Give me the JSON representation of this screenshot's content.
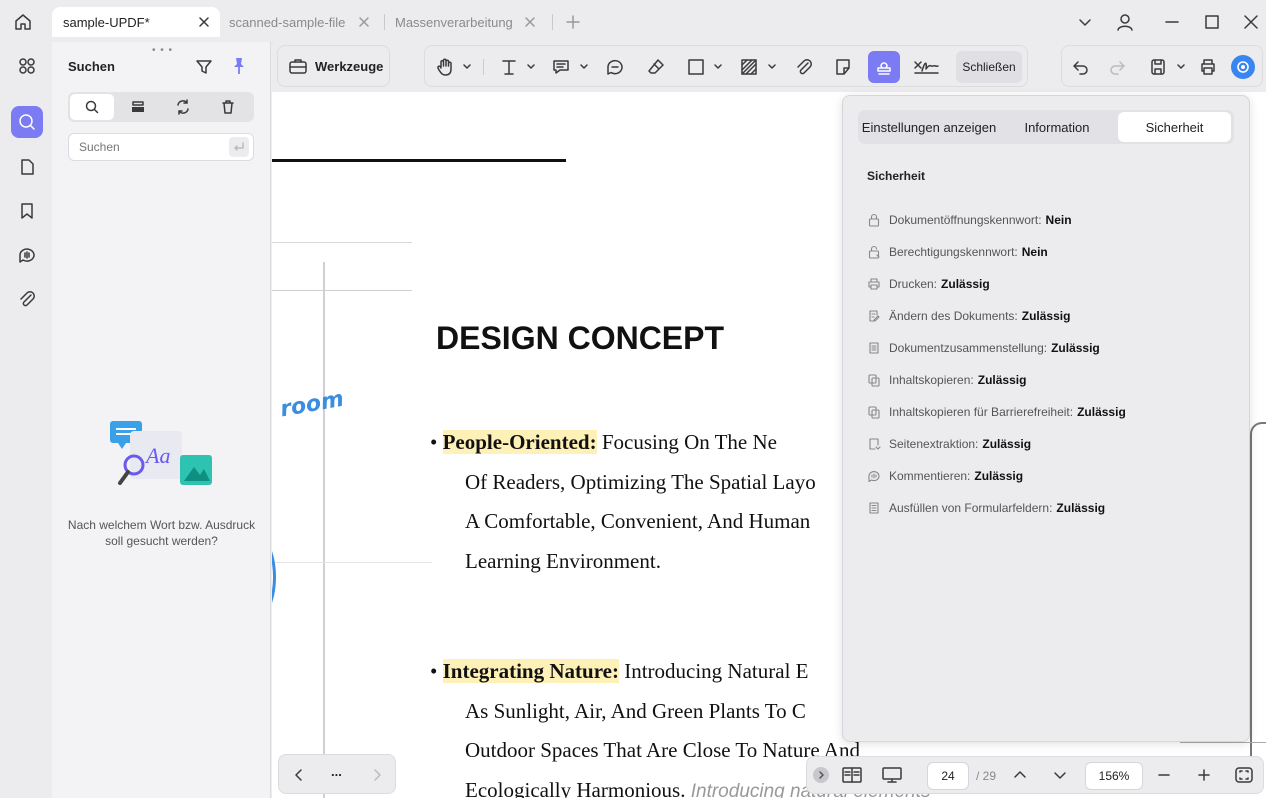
{
  "tabs": [
    {
      "label": "sample-UPDF*",
      "active": true
    },
    {
      "label": "scanned-sample-file",
      "active": false
    },
    {
      "label": "Massenverarbeitung",
      "active": false
    }
  ],
  "search_panel": {
    "title": "Suchen",
    "placeholder": "Suchen",
    "empty_hint_line1": "Nach welchem Wort bzw. Ausdruck",
    "empty_hint_line2": "soll gesucht werden?"
  },
  "toolbar": {
    "tools_label": "Werkzeuge",
    "close_label": "Schließen"
  },
  "document": {
    "handwriting": "room",
    "heading": "DESIGN CONCEPT",
    "bullet1_bold": "People-Oriented:",
    "bullet1_rest": " Focusing On The        Ne",
    "bullet1_line2": "Of Readers, Optimizing The Spatial Layo",
    "bullet1_line3": "A Comfortable, Convenient, And Human",
    "bullet1_line4": "Learning Environment.",
    "bullet2_bold": "Integrating Nature:",
    "bullet2_rest": " Introducing Natural E",
    "bullet2_line2": "As Sunlight, Air, And Green Plants To C",
    "bullet2_line3": "Outdoor Spaces That Are Close To Nature And",
    "bullet2_line4": "Ecologically Harmonious.",
    "bullet2_line4_italic": " Introducing natural elements"
  },
  "properties": {
    "tabs": [
      "Einstellungen anzeigen",
      "Information",
      "Sicherheit"
    ],
    "active_tab": "Sicherheit",
    "section_title": "Sicherheit",
    "rows": [
      {
        "label": "Dokumentöffnungskennwort:",
        "value": "Nein",
        "icon": "lock-icon"
      },
      {
        "label": "Berechtigungskennwort:",
        "value": "Nein",
        "icon": "permission-lock-icon"
      },
      {
        "label": "Drucken:",
        "value": "Zulässig",
        "icon": "printer-icon"
      },
      {
        "label": "Ändern des Dokuments:",
        "value": "Zulässig",
        "icon": "edit-document-icon"
      },
      {
        "label": "Dokumentzusammenstellung:",
        "value": "Zulässig",
        "icon": "document-assembly-icon"
      },
      {
        "label": "Inhaltskopieren:",
        "value": "Zulässig",
        "icon": "copy-icon"
      },
      {
        "label": "Inhaltskopieren für Barrierefreiheit:",
        "value": "Zulässig",
        "icon": "copy-accessibility-icon"
      },
      {
        "label": "Seitenextraktion:",
        "value": "Zulässig",
        "icon": "page-extract-icon"
      },
      {
        "label": "Kommentieren:",
        "value": "Zulässig",
        "icon": "comment-icon"
      },
      {
        "label": "Ausfüllen von Formularfeldern:",
        "value": "Zulässig",
        "icon": "form-field-icon"
      }
    ]
  },
  "page_nav": {
    "more": "...",
    "current_page": "24",
    "total_pages": "/ 29",
    "zoom": "156%"
  },
  "colors": {
    "accent": "#7b7cf4",
    "highlight": "#fdf1b8",
    "handwriting_blue": "#3b8de0"
  }
}
